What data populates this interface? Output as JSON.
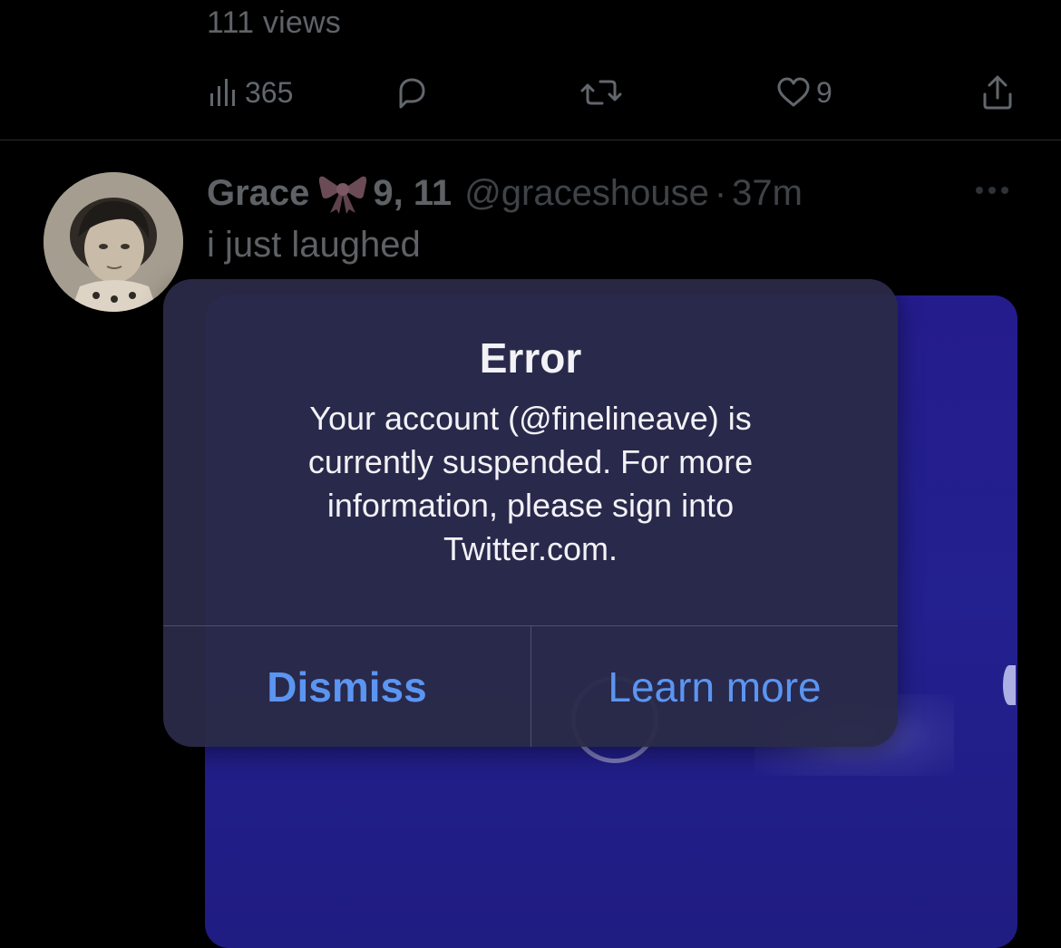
{
  "tweet_above": {
    "views_text": "111 views",
    "analytics_count": "365",
    "like_count": "9"
  },
  "tweet": {
    "author_name": "Grace",
    "name_emoji": "bow-icon",
    "name_suffix": "9, 11",
    "handle": "@graceshouse",
    "dot": "·",
    "time": "37m",
    "text": "i just laughed"
  },
  "alert": {
    "title": "Error",
    "message": "Your account (@finelineave) is currently suspended. For more information, please sign into Twitter.com.",
    "dismiss_label": "Dismiss",
    "learn_more_label": "Learn more"
  },
  "colors": {
    "accent": "#5b95f2",
    "background": "#000000",
    "alert_background": "#2a2a48",
    "media_background": "#23208f"
  }
}
